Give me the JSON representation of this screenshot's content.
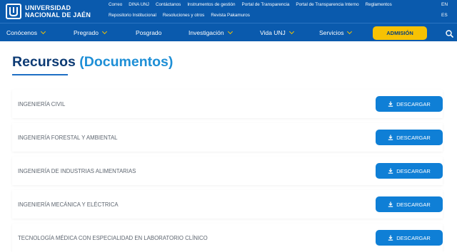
{
  "header": {
    "logo_line1": "UNIVERSIDAD",
    "logo_line2": "NACIONAL DE JAÉN",
    "links_row1": [
      "Correo",
      "DINA UNJ",
      "Contáctanos",
      "Instrumentos de gestión",
      "Portal de Transparencia",
      "Portal de Transparencia Interno",
      "Reglamentos"
    ],
    "links_row2": [
      "Repositorio Institucional",
      "Resoluciones y otros",
      "Revista Pakamuros"
    ],
    "lang_en": "EN",
    "lang_es": "ES"
  },
  "nav": {
    "items": [
      "Conócenos",
      "Pregrado",
      "Posgrado",
      "Investigación",
      "Vida UNJ",
      "Servicios"
    ],
    "admision": "ADMISIÓN",
    "search_icon": "search-icon"
  },
  "main": {
    "title": "Recursos",
    "title_accent": "(Documentos)",
    "rows": [
      {
        "label": "INGENIERÍA CIVIL",
        "button": "DESCARGAR"
      },
      {
        "label": "INGENIERÍA FORESTAL Y AMBIENTAL",
        "button": "DESCARGAR"
      },
      {
        "label": "INGENIERÍA DE INDUSTRIAS ALIMENTARIAS",
        "button": "DESCARGAR"
      },
      {
        "label": "INGENIERÍA MECÁNICA Y ELÉCTRICA",
        "button": "DESCARGAR"
      },
      {
        "label": "TECNOLOGÍA MÉDICA CON ESPECIALIDAD EN LABORATORIO CLÍNICO",
        "button": "DESCARGAR"
      }
    ]
  },
  "colors": {
    "brand_blue": "#0a5aad",
    "accent_yellow": "#f7c203",
    "title_dark": "#0d3b74",
    "title_accent": "#1e8fd6",
    "button_blue": "#0f7fd6"
  }
}
